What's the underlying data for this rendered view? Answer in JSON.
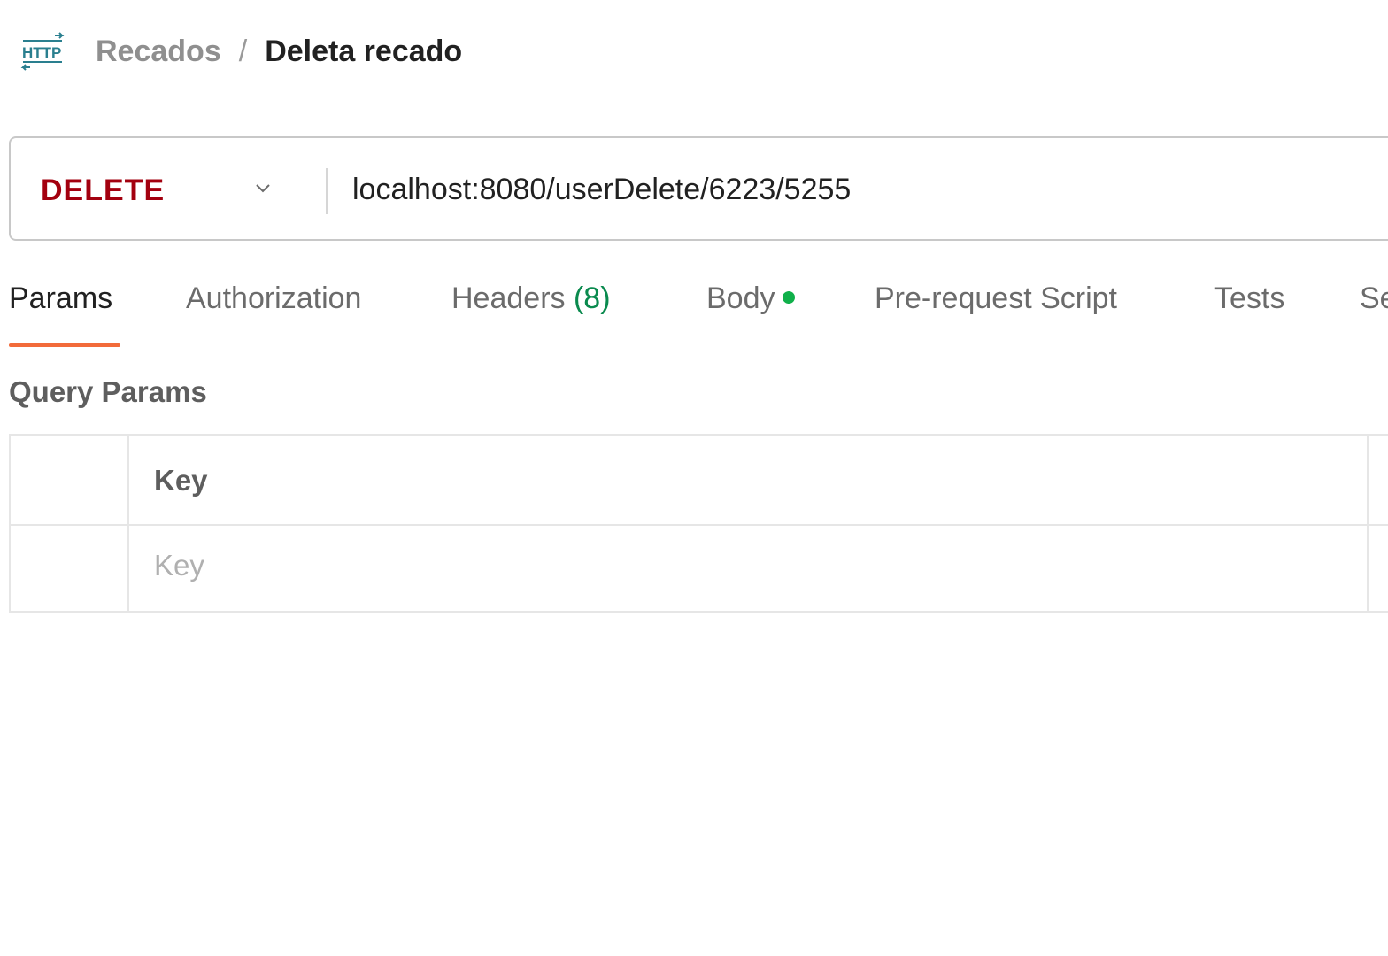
{
  "header": {
    "icon": "http-icon",
    "breadcrumb_parent": "Recados",
    "breadcrumb_separator": "/",
    "title": "Deleta recado"
  },
  "request": {
    "method": "DELETE",
    "method_color": "#a3000f",
    "url": "localhost:8080/userDelete/6223/5255"
  },
  "tabs": [
    {
      "label": "Params",
      "active": true
    },
    {
      "label": "Authorization"
    },
    {
      "label": "Headers",
      "count": "(8)"
    },
    {
      "label": "Body",
      "indicator": "green-dot"
    },
    {
      "label": "Pre-request Script"
    },
    {
      "label": "Tests"
    },
    {
      "label": "Se"
    }
  ],
  "query_params": {
    "title": "Query Params",
    "columns": [
      "Key"
    ],
    "rows": [
      {
        "key_placeholder": "Key",
        "key_value": ""
      }
    ]
  },
  "colors": {
    "accent_underline": "#f26b3a",
    "count_green": "#0a8a4e",
    "body_dot": "#10b04a",
    "http_icon": "#2a7f8f"
  }
}
